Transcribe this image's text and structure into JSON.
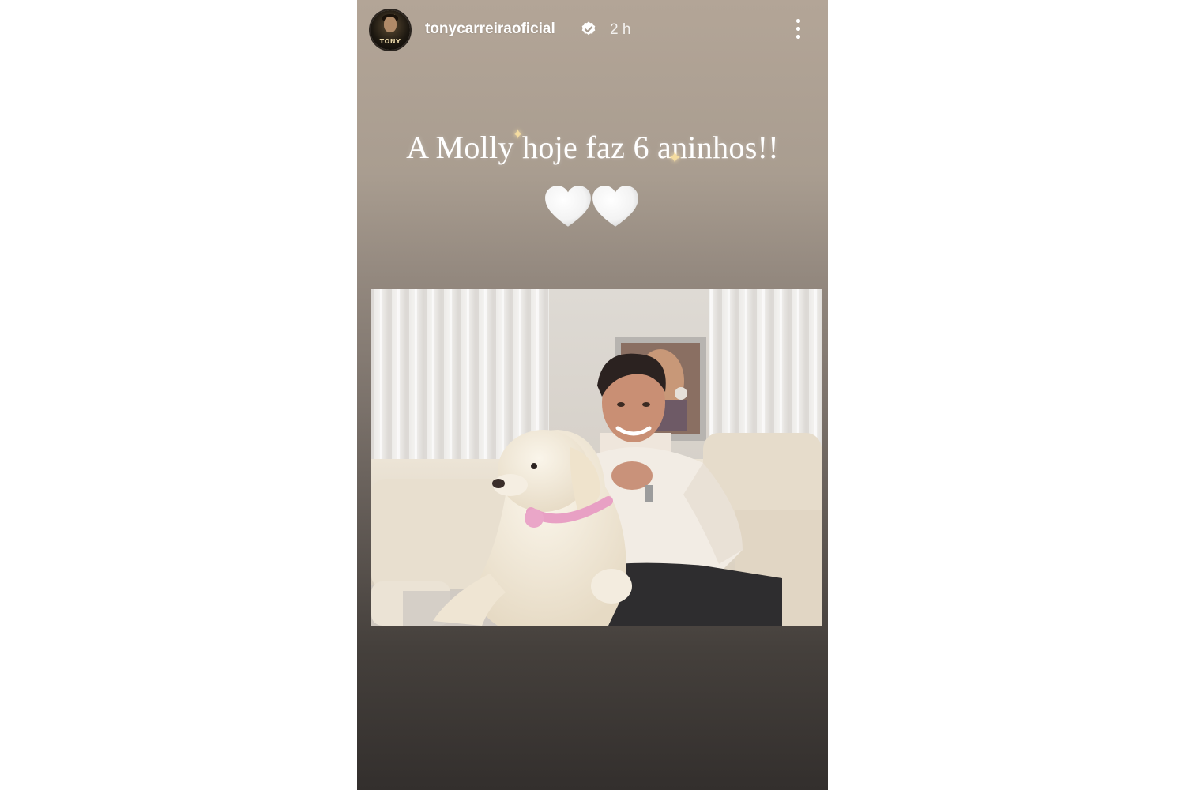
{
  "story": {
    "username": "tonycarreiraoficial",
    "time": "2 h",
    "caption": "A Molly hoje faz 6 aninhos!!",
    "hearts": [
      "white-heart",
      "white-heart"
    ],
    "avatar": {
      "label": "TONY"
    },
    "photo": {
      "subject": "man with golden retriever on sofa",
      "collar_color": "#e8a0c4"
    }
  },
  "icons": {
    "verified": "verified-badge-icon",
    "more": "more-options-icon"
  },
  "colors": {
    "background_top": "#b3a597",
    "background_bottom": "#332f2d",
    "text": "#ffffff"
  }
}
